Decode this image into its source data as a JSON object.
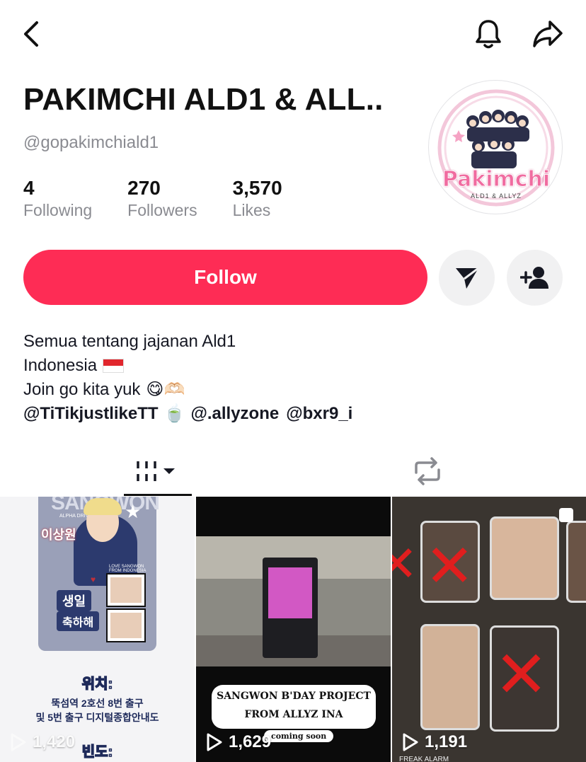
{
  "header": {
    "back_icon": "chevron-left-icon",
    "notification_icon": "bell-icon",
    "share_icon": "share-arrow-icon"
  },
  "profile": {
    "name": "PAKIMCHI ALD1 & ALL..",
    "handle": "@gopakimchiald1",
    "avatar_text": "Pakimchi",
    "avatar_subtext": "ALD1 & ALLYZ"
  },
  "stats": {
    "following_count": "4",
    "following_label": "Following",
    "followers_count": "270",
    "followers_label": "Followers",
    "likes_count": "3,570",
    "likes_label": "Likes"
  },
  "actions": {
    "follow_label": "Follow",
    "message_icon": "send-icon",
    "add_friend_icon": "person-plus-icon",
    "accent": "#fe2c55"
  },
  "bio": {
    "line1": "Semua tentang jajanan Ald1",
    "line2": "Indonesia",
    "line3": "Join go kita yuk",
    "mention1": "@TiTikjustlikeTT",
    "mention2": "@.allyzone",
    "mention3": "@bxr9_i",
    "line3_emoji": "😋🫶🏻",
    "mention_emoji": "🍵"
  },
  "tabs": {
    "videos_icon": "grid-icon",
    "repost_icon": "repost-icon"
  },
  "videos": [
    {
      "views": "1,420",
      "banner": "SANGWON",
      "subbanner": "ALPHA DRIVE ONE",
      "korean_name": "이상원",
      "korean_bday1": "생일",
      "korean_bday2": "축하해",
      "love_text": "LOVE SANGWON FROM INDONESIA",
      "location_label": "위치:",
      "location_line1": "뚝섬역 2호선 8번 출구",
      "location_line2": "및 5번 출구 디지털종합안내도",
      "period_label": "빈도:"
    },
    {
      "views": "1,629",
      "caption_line1": "SANGWON B'DAY PROJECT",
      "caption_line2": "FROM ALLYZ INA",
      "caption_line3": "coming soon"
    },
    {
      "views": "1,191",
      "caption_bottom": "FREAK ALARM"
    }
  ]
}
